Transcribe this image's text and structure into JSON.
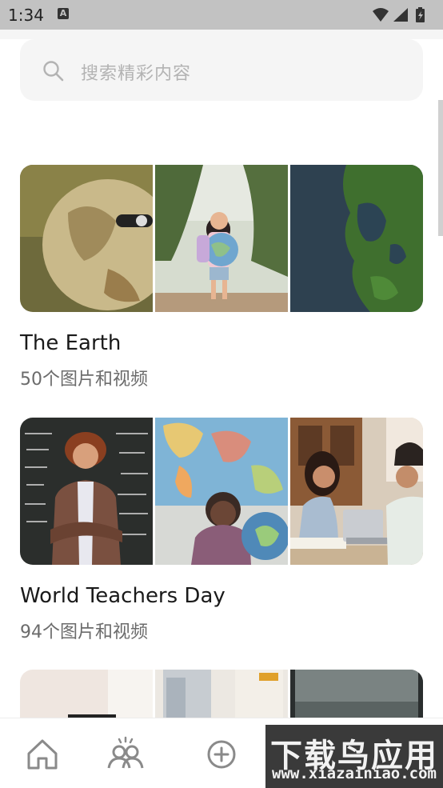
{
  "status_bar": {
    "time": "1:34",
    "notification_badge": "A"
  },
  "search": {
    "placeholder": "搜索精彩内容",
    "icon": "search-icon"
  },
  "albums": [
    {
      "title": "The Earth",
      "count": "50个图片和视频",
      "images": [
        "globe-closeup",
        "girl-holding-globe",
        "aerial-island"
      ]
    },
    {
      "title": "World Teachers Day",
      "count": "94个图片和视频",
      "images": [
        "teacher-at-chalkboard",
        "woman-with-globe-and-map",
        "students-studying"
      ]
    },
    {
      "title": "",
      "count": "",
      "images": [
        "room-interior",
        "window-view",
        "sea-view"
      ]
    }
  ],
  "bottom_nav": [
    {
      "icon": "home-icon"
    },
    {
      "icon": "community-icon"
    },
    {
      "icon": "add-circle-icon"
    }
  ],
  "watermark": {
    "text": "下载鸟应用",
    "url": "www.xiazainiao.com"
  },
  "colors": {
    "status_bar": "#c2c2c2",
    "search_bg": "#f5f5f5",
    "title": "#1a1a1a",
    "subtitle": "#6b6b6b"
  }
}
